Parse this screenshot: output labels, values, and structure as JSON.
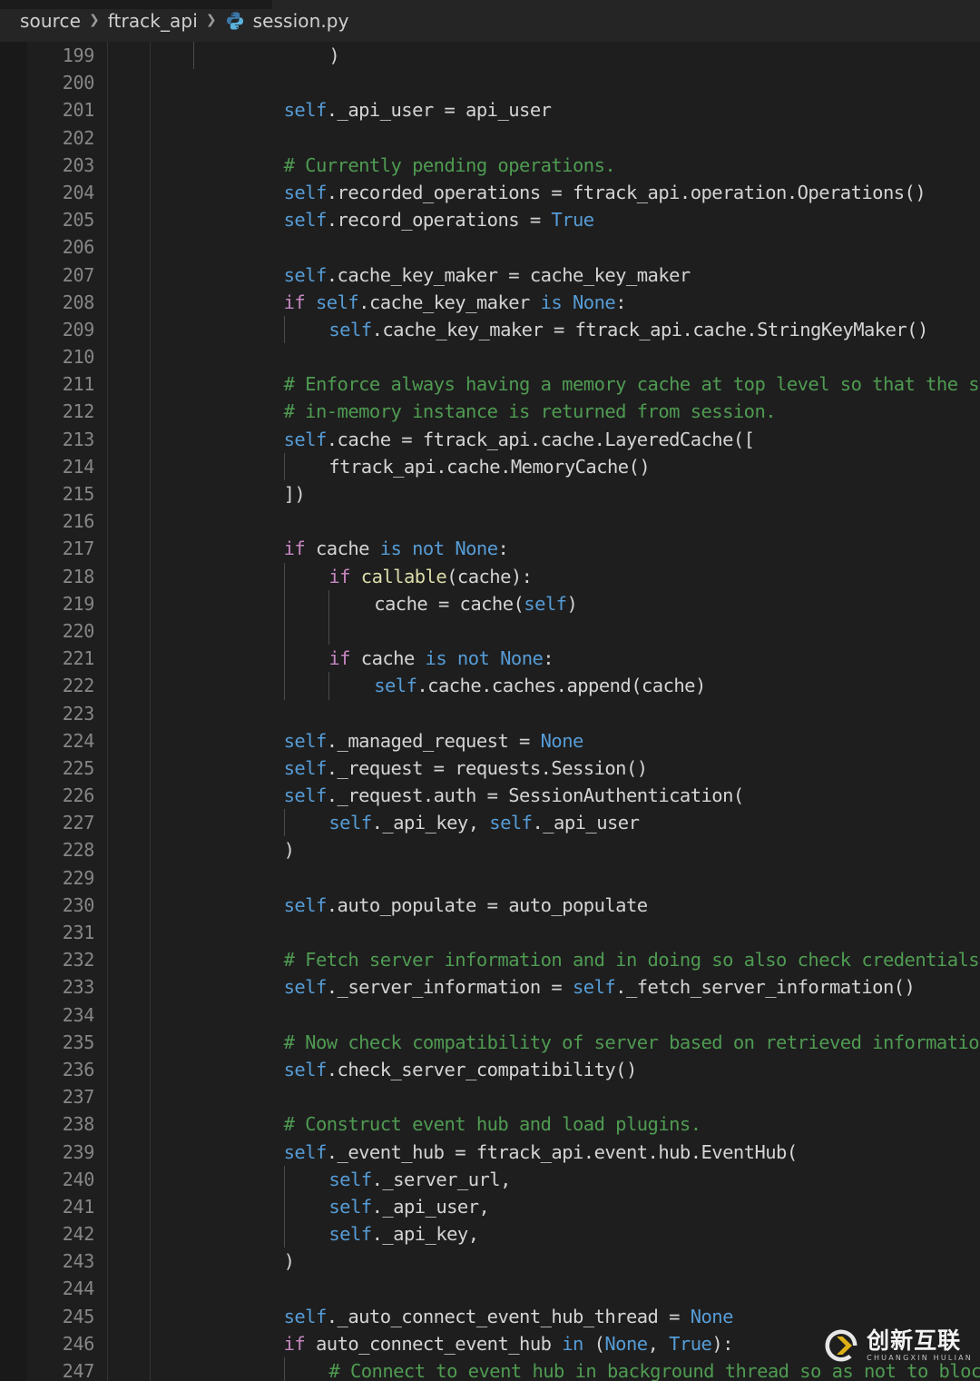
{
  "breadcrumb": {
    "separator": "❯",
    "items": [
      {
        "label": "source",
        "icon": null
      },
      {
        "label": "ftrack_api",
        "icon": null
      },
      {
        "label": "session.py",
        "icon": "python-file-icon"
      }
    ]
  },
  "editor": {
    "language": "python",
    "first_line_number": 199,
    "last_line_number": 247,
    "colors": {
      "background": "#1e1e1e",
      "gutter_text": "#868686",
      "default_text": "#d4d4d4",
      "self_keyword": "#569cd6",
      "control_keyword": "#c586c0",
      "constant": "#569cd6",
      "comment": "#4f9b52",
      "builtin_function": "#dcdcaa",
      "indent_guide": "#4b4b4b",
      "breadcrumb_bg": "#252526"
    },
    "lines": [
      {
        "n": 199,
        "indent": 3,
        "guides": [
          0
        ],
        "tokens": [
          {
            "t": ")",
            "c": "punct"
          }
        ]
      },
      {
        "n": 200,
        "indent": 0,
        "guides": [],
        "tokens": []
      },
      {
        "n": 201,
        "indent": 2,
        "guides": [],
        "tokens": [
          {
            "t": "self",
            "c": "self"
          },
          {
            "t": "._api_user = api_user",
            "c": "plain"
          }
        ]
      },
      {
        "n": 202,
        "indent": 0,
        "guides": [],
        "tokens": []
      },
      {
        "n": 203,
        "indent": 2,
        "guides": [],
        "tokens": [
          {
            "t": "# Currently pending operations.",
            "c": "cmt"
          }
        ]
      },
      {
        "n": 204,
        "indent": 2,
        "guides": [],
        "tokens": [
          {
            "t": "self",
            "c": "self"
          },
          {
            "t": ".recorded_operations = ftrack_api.operation.Operations()",
            "c": "plain"
          }
        ]
      },
      {
        "n": 205,
        "indent": 2,
        "guides": [],
        "tokens": [
          {
            "t": "self",
            "c": "self"
          },
          {
            "t": ".record_operations = ",
            "c": "plain"
          },
          {
            "t": "True",
            "c": "const"
          }
        ]
      },
      {
        "n": 206,
        "indent": 0,
        "guides": [],
        "tokens": []
      },
      {
        "n": 207,
        "indent": 2,
        "guides": [],
        "tokens": [
          {
            "t": "self",
            "c": "self"
          },
          {
            "t": ".cache_key_maker = cache_key_maker",
            "c": "plain"
          }
        ]
      },
      {
        "n": 208,
        "indent": 2,
        "guides": [],
        "tokens": [
          {
            "t": "if",
            "c": "kw"
          },
          {
            "t": " ",
            "c": "plain"
          },
          {
            "t": "self",
            "c": "self"
          },
          {
            "t": ".cache_key_maker ",
            "c": "plain"
          },
          {
            "t": "is",
            "c": "op"
          },
          {
            "t": " ",
            "c": "plain"
          },
          {
            "t": "None",
            "c": "const"
          },
          {
            "t": ":",
            "c": "punct"
          }
        ]
      },
      {
        "n": 209,
        "indent": 3,
        "guides": [
          2
        ],
        "tokens": [
          {
            "t": "self",
            "c": "self"
          },
          {
            "t": ".cache_key_maker = ftrack_api.cache.StringKeyMaker()",
            "c": "plain"
          }
        ]
      },
      {
        "n": 210,
        "indent": 0,
        "guides": [],
        "tokens": []
      },
      {
        "n": 211,
        "indent": 2,
        "guides": [],
        "tokens": [
          {
            "t": "# Enforce always having a memory cache at top level so that the same",
            "c": "cmt"
          }
        ]
      },
      {
        "n": 212,
        "indent": 2,
        "guides": [],
        "tokens": [
          {
            "t": "# in-memory instance is returned from session.",
            "c": "cmt"
          }
        ]
      },
      {
        "n": 213,
        "indent": 2,
        "guides": [],
        "tokens": [
          {
            "t": "self",
            "c": "self"
          },
          {
            "t": ".cache = ftrack_api.cache.LayeredCache([",
            "c": "plain"
          }
        ]
      },
      {
        "n": 214,
        "indent": 3,
        "guides": [
          2
        ],
        "tokens": [
          {
            "t": "ftrack_api.cache.MemoryCache()",
            "c": "plain"
          }
        ]
      },
      {
        "n": 215,
        "indent": 2,
        "guides": [],
        "tokens": [
          {
            "t": "])",
            "c": "punct"
          }
        ]
      },
      {
        "n": 216,
        "indent": 0,
        "guides": [],
        "tokens": []
      },
      {
        "n": 217,
        "indent": 2,
        "guides": [],
        "tokens": [
          {
            "t": "if",
            "c": "kw"
          },
          {
            "t": " cache ",
            "c": "plain"
          },
          {
            "t": "is",
            "c": "op"
          },
          {
            "t": " ",
            "c": "plain"
          },
          {
            "t": "not",
            "c": "op"
          },
          {
            "t": " ",
            "c": "plain"
          },
          {
            "t": "None",
            "c": "const"
          },
          {
            "t": ":",
            "c": "punct"
          }
        ]
      },
      {
        "n": 218,
        "indent": 3,
        "guides": [
          2
        ],
        "tokens": [
          {
            "t": "if",
            "c": "kw"
          },
          {
            "t": " ",
            "c": "plain"
          },
          {
            "t": "callable",
            "c": "fn"
          },
          {
            "t": "(cache):",
            "c": "plain"
          }
        ]
      },
      {
        "n": 219,
        "indent": 4,
        "guides": [
          2,
          3
        ],
        "tokens": [
          {
            "t": "cache = cache(",
            "c": "plain"
          },
          {
            "t": "self",
            "c": "self"
          },
          {
            "t": ")",
            "c": "plain"
          }
        ]
      },
      {
        "n": 220,
        "indent": 0,
        "guides": [
          2,
          3
        ],
        "tokens": []
      },
      {
        "n": 221,
        "indent": 3,
        "guides": [
          2
        ],
        "tokens": [
          {
            "t": "if",
            "c": "kw"
          },
          {
            "t": " cache ",
            "c": "plain"
          },
          {
            "t": "is",
            "c": "op"
          },
          {
            "t": " ",
            "c": "plain"
          },
          {
            "t": "not",
            "c": "op"
          },
          {
            "t": " ",
            "c": "plain"
          },
          {
            "t": "None",
            "c": "const"
          },
          {
            "t": ":",
            "c": "punct"
          }
        ]
      },
      {
        "n": 222,
        "indent": 4,
        "guides": [
          2,
          3
        ],
        "tokens": [
          {
            "t": "self",
            "c": "self"
          },
          {
            "t": ".cache.caches.append(cache)",
            "c": "plain"
          }
        ]
      },
      {
        "n": 223,
        "indent": 0,
        "guides": [],
        "tokens": []
      },
      {
        "n": 224,
        "indent": 2,
        "guides": [],
        "tokens": [
          {
            "t": "self",
            "c": "self"
          },
          {
            "t": "._managed_request = ",
            "c": "plain"
          },
          {
            "t": "None",
            "c": "const"
          }
        ]
      },
      {
        "n": 225,
        "indent": 2,
        "guides": [],
        "tokens": [
          {
            "t": "self",
            "c": "self"
          },
          {
            "t": "._request = requests.Session()",
            "c": "plain"
          }
        ]
      },
      {
        "n": 226,
        "indent": 2,
        "guides": [],
        "tokens": [
          {
            "t": "self",
            "c": "self"
          },
          {
            "t": "._request.auth = SessionAuthentication(",
            "c": "plain"
          }
        ]
      },
      {
        "n": 227,
        "indent": 3,
        "guides": [
          2
        ],
        "tokens": [
          {
            "t": "self",
            "c": "self"
          },
          {
            "t": "._api_key, ",
            "c": "plain"
          },
          {
            "t": "self",
            "c": "self"
          },
          {
            "t": "._api_user",
            "c": "plain"
          }
        ]
      },
      {
        "n": 228,
        "indent": 2,
        "guides": [],
        "tokens": [
          {
            "t": ")",
            "c": "punct"
          }
        ]
      },
      {
        "n": 229,
        "indent": 0,
        "guides": [],
        "tokens": []
      },
      {
        "n": 230,
        "indent": 2,
        "guides": [],
        "tokens": [
          {
            "t": "self",
            "c": "self"
          },
          {
            "t": ".auto_populate = auto_populate",
            "c": "plain"
          }
        ]
      },
      {
        "n": 231,
        "indent": 0,
        "guides": [],
        "tokens": []
      },
      {
        "n": 232,
        "indent": 2,
        "guides": [],
        "tokens": [
          {
            "t": "# Fetch server information and in doing so also check credentials.",
            "c": "cmt"
          }
        ]
      },
      {
        "n": 233,
        "indent": 2,
        "guides": [],
        "tokens": [
          {
            "t": "self",
            "c": "self"
          },
          {
            "t": "._server_information = ",
            "c": "plain"
          },
          {
            "t": "self",
            "c": "self"
          },
          {
            "t": "._fetch_server_information()",
            "c": "plain"
          }
        ]
      },
      {
        "n": 234,
        "indent": 0,
        "guides": [],
        "tokens": []
      },
      {
        "n": 235,
        "indent": 2,
        "guides": [],
        "tokens": [
          {
            "t": "# Now check compatibility of server based on retrieved information.",
            "c": "cmt"
          }
        ]
      },
      {
        "n": 236,
        "indent": 2,
        "guides": [],
        "tokens": [
          {
            "t": "self",
            "c": "self"
          },
          {
            "t": ".check_server_compatibility()",
            "c": "plain"
          }
        ]
      },
      {
        "n": 237,
        "indent": 0,
        "guides": [],
        "tokens": []
      },
      {
        "n": 238,
        "indent": 2,
        "guides": [],
        "tokens": [
          {
            "t": "# Construct event hub and load plugins.",
            "c": "cmt"
          }
        ]
      },
      {
        "n": 239,
        "indent": 2,
        "guides": [],
        "tokens": [
          {
            "t": "self",
            "c": "self"
          },
          {
            "t": "._event_hub = ftrack_api.event.hub.EventHub(",
            "c": "plain"
          }
        ]
      },
      {
        "n": 240,
        "indent": 3,
        "guides": [
          2
        ],
        "tokens": [
          {
            "t": "self",
            "c": "self"
          },
          {
            "t": "._server_url,",
            "c": "plain"
          }
        ]
      },
      {
        "n": 241,
        "indent": 3,
        "guides": [
          2
        ],
        "tokens": [
          {
            "t": "self",
            "c": "self"
          },
          {
            "t": "._api_user,",
            "c": "plain"
          }
        ]
      },
      {
        "n": 242,
        "indent": 3,
        "guides": [
          2
        ],
        "tokens": [
          {
            "t": "self",
            "c": "self"
          },
          {
            "t": "._api_key,",
            "c": "plain"
          }
        ]
      },
      {
        "n": 243,
        "indent": 2,
        "guides": [],
        "tokens": [
          {
            "t": ")",
            "c": "punct"
          }
        ]
      },
      {
        "n": 244,
        "indent": 0,
        "guides": [],
        "tokens": []
      },
      {
        "n": 245,
        "indent": 2,
        "guides": [],
        "tokens": [
          {
            "t": "self",
            "c": "self"
          },
          {
            "t": "._auto_connect_event_hub_thread = ",
            "c": "plain"
          },
          {
            "t": "None",
            "c": "const"
          }
        ]
      },
      {
        "n": 246,
        "indent": 2,
        "guides": [],
        "tokens": [
          {
            "t": "if",
            "c": "kw"
          },
          {
            "t": " auto_connect_event_hub ",
            "c": "plain"
          },
          {
            "t": "in",
            "c": "op"
          },
          {
            "t": " (",
            "c": "plain"
          },
          {
            "t": "None",
            "c": "const"
          },
          {
            "t": ", ",
            "c": "plain"
          },
          {
            "t": "True",
            "c": "const"
          },
          {
            "t": "):",
            "c": "punct"
          }
        ]
      },
      {
        "n": 247,
        "indent": 3,
        "guides": [
          2
        ],
        "tokens": [
          {
            "t": "# Connect to event hub in background thread so as not to block main",
            "c": "cmt"
          }
        ]
      }
    ]
  },
  "watermark": {
    "cn_text": "创新互联",
    "en_text": "CHUANGXIN HULIAN",
    "logo_letter": "X"
  }
}
